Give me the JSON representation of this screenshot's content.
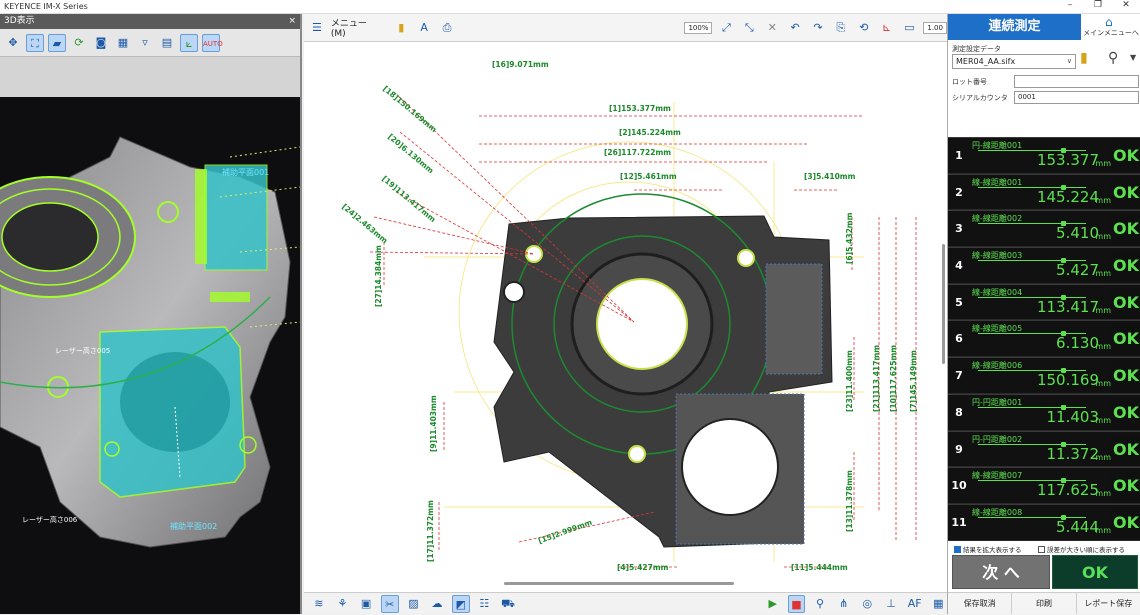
{
  "window": {
    "title": "KEYENCE IM-X Series"
  },
  "left_panel": {
    "header": "3D表示",
    "close": "×",
    "labels": [
      "補助平面001",
      "レーザー高さ005",
      "レーザー高さ006",
      "補助平面002"
    ]
  },
  "middle": {
    "menu_label": "メニュー(M)",
    "zoom": "100%",
    "zoom_out": "1.00",
    "dims": [
      {
        "id": "[16]",
        "value": "9.071mm"
      },
      {
        "id": "[18]",
        "value": "150.169mm"
      },
      {
        "id": "[1]",
        "value": "153.377mm"
      },
      {
        "id": "[2]",
        "value": "145.224mm"
      },
      {
        "id": "[20]",
        "value": "6.130mm"
      },
      {
        "id": "[26]",
        "value": "117.722mm"
      },
      {
        "id": "[12]",
        "value": "5.461mm"
      },
      {
        "id": "[3]",
        "value": "5.410mm"
      },
      {
        "id": "[19]",
        "value": "113.417mm"
      },
      {
        "id": "[24]",
        "value": "2.463mm"
      },
      {
        "id": "[6]",
        "value": "5.432mm"
      },
      {
        "id": "[27]",
        "value": "14.384mm"
      },
      {
        "id": "[23]",
        "value": "11.400mm"
      },
      {
        "id": "[21]",
        "value": "113.417mm"
      },
      {
        "id": "[10]",
        "value": "117.625mm"
      },
      {
        "id": "[7]",
        "value": "145.149mm"
      },
      {
        "id": "[9]",
        "value": "11.403mm"
      },
      {
        "id": "[14]",
        "value": "11.372mm"
      },
      {
        "id": "[15]",
        "value": "2.999mm"
      },
      {
        "id": "[4]",
        "value": "5.427mm"
      },
      {
        "id": "[11]",
        "value": "5.444mm"
      },
      {
        "id": "[13]",
        "value": "11.378mm"
      },
      {
        "id": "[17]",
        "value": "11.372mm"
      }
    ]
  },
  "right_panel": {
    "mode": "連続測定",
    "main_menu": "メインメニューへ",
    "settings_label": "測定設定データ",
    "settings_file": "MER04_AA.sifx",
    "lot_label": "ロット番号",
    "lot_value": "",
    "serial_label": "シリアルカウンタ",
    "serial_value": "0001",
    "results": [
      {
        "num": "1",
        "name": "円-線距離001",
        "value": "153.377",
        "unit": "mm",
        "status": "OK"
      },
      {
        "num": "2",
        "name": "線-線距離001",
        "value": "145.224",
        "unit": "mm",
        "status": "OK"
      },
      {
        "num": "3",
        "name": "線-線距離002",
        "value": "5.410",
        "unit": "mm",
        "status": "OK"
      },
      {
        "num": "4",
        "name": "線-線距離003",
        "value": "5.427",
        "unit": "mm",
        "status": "OK"
      },
      {
        "num": "5",
        "name": "線-線距離004",
        "value": "113.417",
        "unit": "mm",
        "status": "OK"
      },
      {
        "num": "6",
        "name": "線-線距離005",
        "value": "6.130",
        "unit": "mm",
        "status": "OK"
      },
      {
        "num": "7",
        "name": "線-線距離006",
        "value": "150.169",
        "unit": "mm",
        "status": "OK"
      },
      {
        "num": "8",
        "name": "円-円距離001",
        "value": "11.403",
        "unit": "mm",
        "status": "OK"
      },
      {
        "num": "9",
        "name": "円-円距離002",
        "value": "11.372",
        "unit": "mm",
        "status": "OK"
      },
      {
        "num": "10",
        "name": "線-線距離007",
        "value": "117.625",
        "unit": "mm",
        "status": "OK"
      },
      {
        "num": "11",
        "name": "線-線距離008",
        "value": "5.444",
        "unit": "mm",
        "status": "OK"
      }
    ],
    "check1": "結果を拡大表示する",
    "check2": "誤差が大きい順に表示する",
    "next_button": "次 へ",
    "ok_button": "OK",
    "actions": [
      "保存取消",
      "印刷",
      "レポート保存"
    ]
  }
}
